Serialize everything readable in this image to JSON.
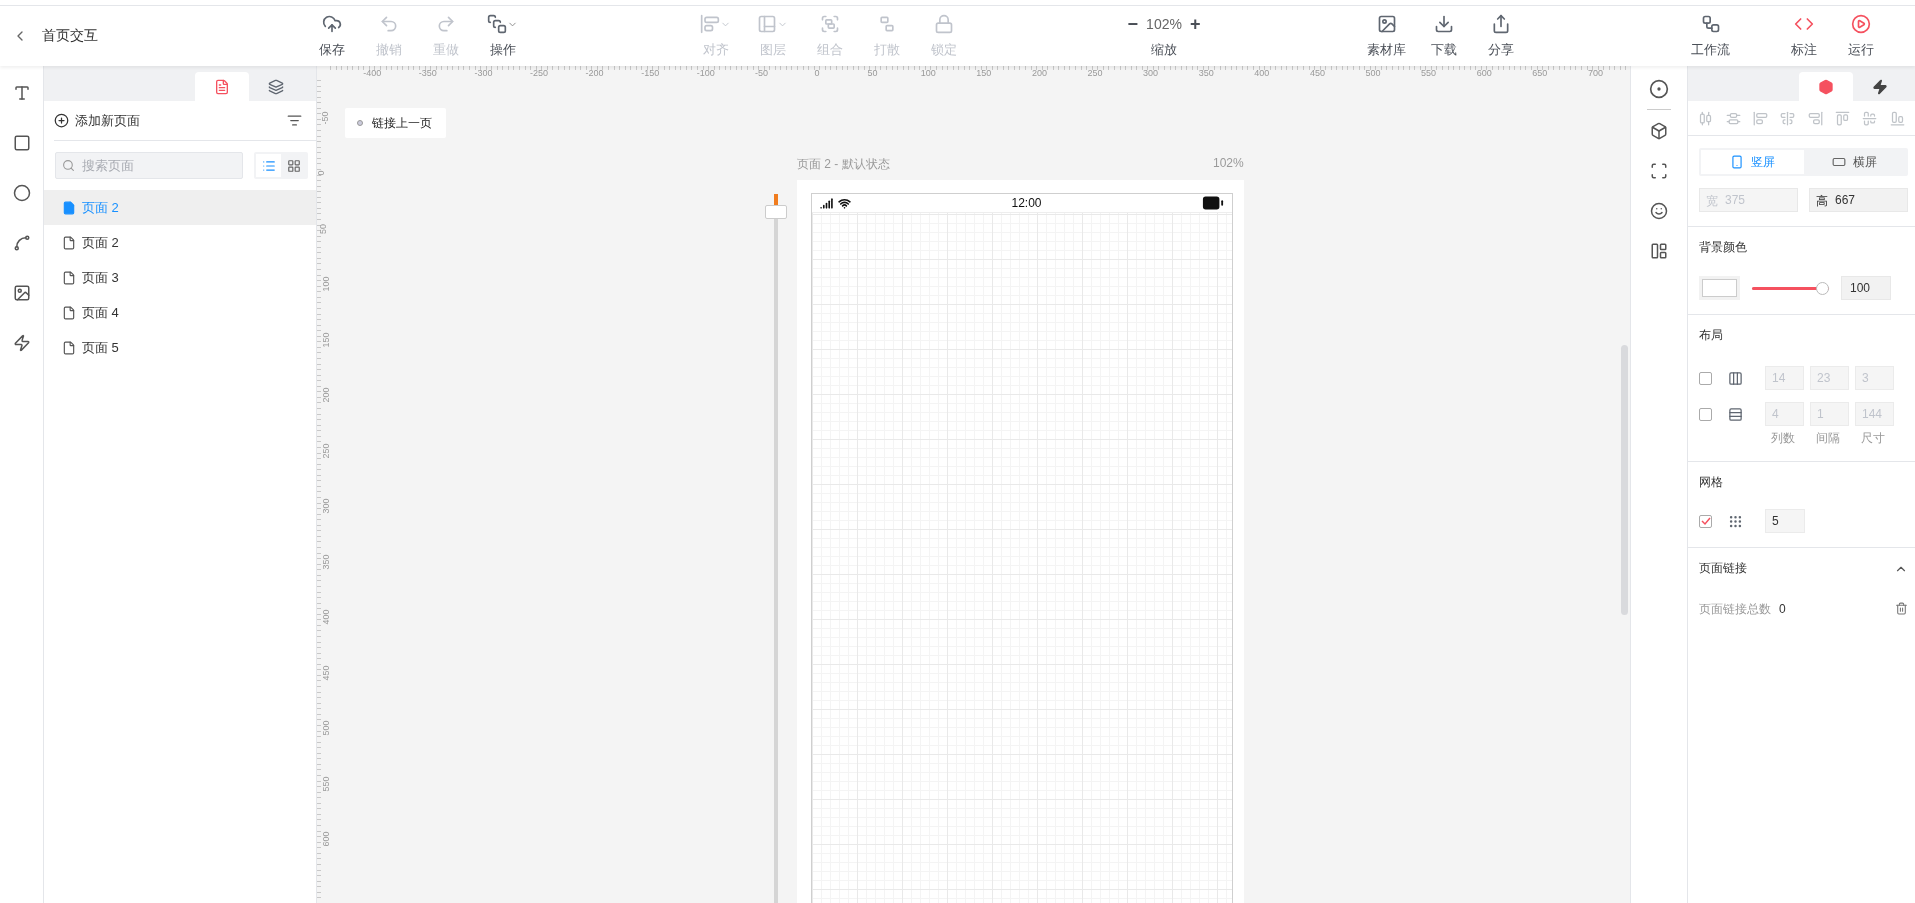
{
  "header": {
    "back_label": "首页交互",
    "left_groups": [
      [
        {
          "label": "保存",
          "kind": "save",
          "disabled": false,
          "has_menu": false
        },
        {
          "label": "撤销",
          "kind": "undo",
          "disabled": true,
          "has_menu": false
        },
        {
          "label": "重做",
          "kind": "redo",
          "disabled": true,
          "has_menu": false
        },
        {
          "label": "操作",
          "kind": "operate",
          "disabled": false,
          "has_menu": true
        }
      ],
      [
        {
          "label": "对齐",
          "kind": "align",
          "disabled": true,
          "has_menu": true
        },
        {
          "label": "图层",
          "kind": "layer",
          "disabled": true,
          "has_menu": true
        },
        {
          "label": "组合",
          "kind": "group",
          "disabled": true,
          "has_menu": false
        },
        {
          "label": "打散",
          "kind": "ungroup",
          "disabled": true,
          "has_menu": false
        },
        {
          "label": "锁定",
          "kind": "lock",
          "disabled": true,
          "has_menu": false
        }
      ]
    ],
    "zoom": {
      "minus": "−",
      "value": "102%",
      "plus": "+",
      "label": "缩放"
    },
    "right_groups": [
      [
        {
          "label": "素材库",
          "kind": "assets",
          "disabled": false,
          "has_menu": false
        },
        {
          "label": "下载",
          "kind": "download",
          "disabled": false,
          "has_menu": false
        },
        {
          "label": "分享",
          "kind": "share",
          "disabled": false,
          "has_menu": false
        }
      ],
      [
        {
          "label": "工作流",
          "kind": "workflow",
          "disabled": false,
          "has_menu": false
        }
      ],
      [
        {
          "label": "标注",
          "kind": "annotate",
          "disabled": false,
          "has_menu": false
        },
        {
          "label": "运行",
          "kind": "run",
          "disabled": false,
          "has_menu": false
        }
      ]
    ]
  },
  "tools": [
    {
      "kind": "text"
    },
    {
      "kind": "rect"
    },
    {
      "kind": "ellipse"
    },
    {
      "kind": "line"
    },
    {
      "kind": "image"
    },
    {
      "kind": "interaction"
    }
  ],
  "pages_panel": {
    "tabs": [
      {
        "kind": "pages",
        "selected": true
      },
      {
        "kind": "layers",
        "selected": false
      }
    ],
    "add_label": "添加新页面",
    "search": {
      "placeholder": "搜索页面"
    },
    "view_modes": [
      {
        "kind": "list",
        "selected": true
      },
      {
        "kind": "grid",
        "selected": false
      }
    ],
    "pages": [
      {
        "label": "页面 2",
        "selected": true
      },
      {
        "label": "页面 2",
        "selected": false
      },
      {
        "label": "页面 3",
        "selected": false
      },
      {
        "label": "页面 4",
        "selected": false
      },
      {
        "label": "页面 5",
        "selected": false
      }
    ]
  },
  "canvas": {
    "x_ruler": [
      "-400",
      "-350",
      "-300",
      "-250",
      "-200",
      "-150",
      "-100",
      "-50",
      "0",
      "50",
      "100",
      "150",
      "200",
      "250",
      "300",
      "350",
      "400",
      "450",
      "500",
      "550",
      "600",
      "650",
      "700"
    ],
    "y_ruler": [
      "-50",
      "0",
      "50",
      "100",
      "150",
      "200",
      "250",
      "300",
      "350",
      "400",
      "450",
      "500",
      "550",
      "600"
    ],
    "link_button": "链接上一页",
    "page_slider": {
      "level": 0.02
    },
    "artboard": {
      "title": "页面 2 - 默认状态",
      "zoom": "102%",
      "time": "12:00"
    }
  },
  "side_strip": [
    {
      "kind": "target"
    },
    {
      "kind": "cube"
    },
    {
      "kind": "scan"
    },
    {
      "kind": "smile"
    },
    {
      "kind": "layout"
    }
  ],
  "props": {
    "tabs": [
      {
        "kind": "style",
        "selected": true
      },
      {
        "kind": "interaction",
        "selected": false
      }
    ],
    "align_tools": [
      {
        "kind": "distribute-h"
      },
      {
        "kind": "distribute-v"
      },
      {
        "kind": "left"
      },
      {
        "kind": "center-h"
      },
      {
        "kind": "right"
      },
      {
        "kind": "top"
      },
      {
        "kind": "center-v"
      },
      {
        "kind": "bottom"
      }
    ],
    "orientation": [
      {
        "label": "竖屏",
        "kind": "portrait",
        "selected": true
      },
      {
        "label": "横屏",
        "kind": "landscape",
        "selected": false
      }
    ],
    "size": [
      {
        "prefix": "宽",
        "value": "375",
        "disabled": true
      },
      {
        "prefix": "高",
        "value": "667",
        "disabled": false
      }
    ],
    "background": {
      "title": "背景颜色",
      "opacity": {
        "level": 1
      },
      "value": "100"
    },
    "layout": {
      "title": "布局",
      "rows": [
        {
          "kind": "columns",
          "checked": false,
          "values": [
            "14",
            "23",
            "3"
          ]
        },
        {
          "kind": "rows",
          "checked": false,
          "values": [
            "4",
            "1",
            "144"
          ]
        }
      ],
      "captions": [
        "列数",
        "间隔",
        "尺寸"
      ]
    },
    "grid": {
      "title": "网格",
      "checked": true,
      "value": "5"
    },
    "links": {
      "title": "页面链接",
      "expanded": true,
      "label": "页面链接总数",
      "count": "0"
    }
  }
}
